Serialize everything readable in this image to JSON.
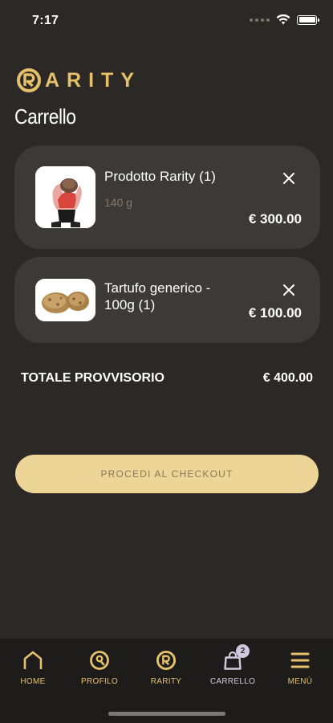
{
  "status_bar": {
    "time": "7:17"
  },
  "brand": {
    "logo_text": "ARITY",
    "logo_letter": "R"
  },
  "page": {
    "title": "Carrello"
  },
  "cart": {
    "items": [
      {
        "name": "Prodotto Rarity (1)",
        "weight": "140 g",
        "price": "€ 300.00",
        "thumb": "person-holding-truffle-photo"
      },
      {
        "name": "Tartufo generico - 100g (1)",
        "weight": "",
        "price": "€ 100.00",
        "thumb": "truffles-photo"
      }
    ],
    "total_label": "TOTALE PROVVISORIO",
    "total_value": "€ 400.00",
    "checkout_label": "PROCEDI AL CHECKOUT"
  },
  "tab_bar": {
    "items": [
      {
        "label": "HOME",
        "icon": "home-icon"
      },
      {
        "label": "PROFILO",
        "icon": "profile-icon"
      },
      {
        "label": "RARITY",
        "icon": "rarity-logo-icon"
      },
      {
        "label": "CARRELLO",
        "icon": "bag-icon",
        "badge": "2"
      },
      {
        "label": "MENÙ",
        "icon": "menu-icon"
      }
    ]
  },
  "colors": {
    "background": "#2b2826",
    "card": "#3c3937",
    "accent_gold": "#e4c06b",
    "button": "#ecd596",
    "active_tab": "#cfc8df",
    "tab_bar_bg": "#1e1c1a"
  }
}
